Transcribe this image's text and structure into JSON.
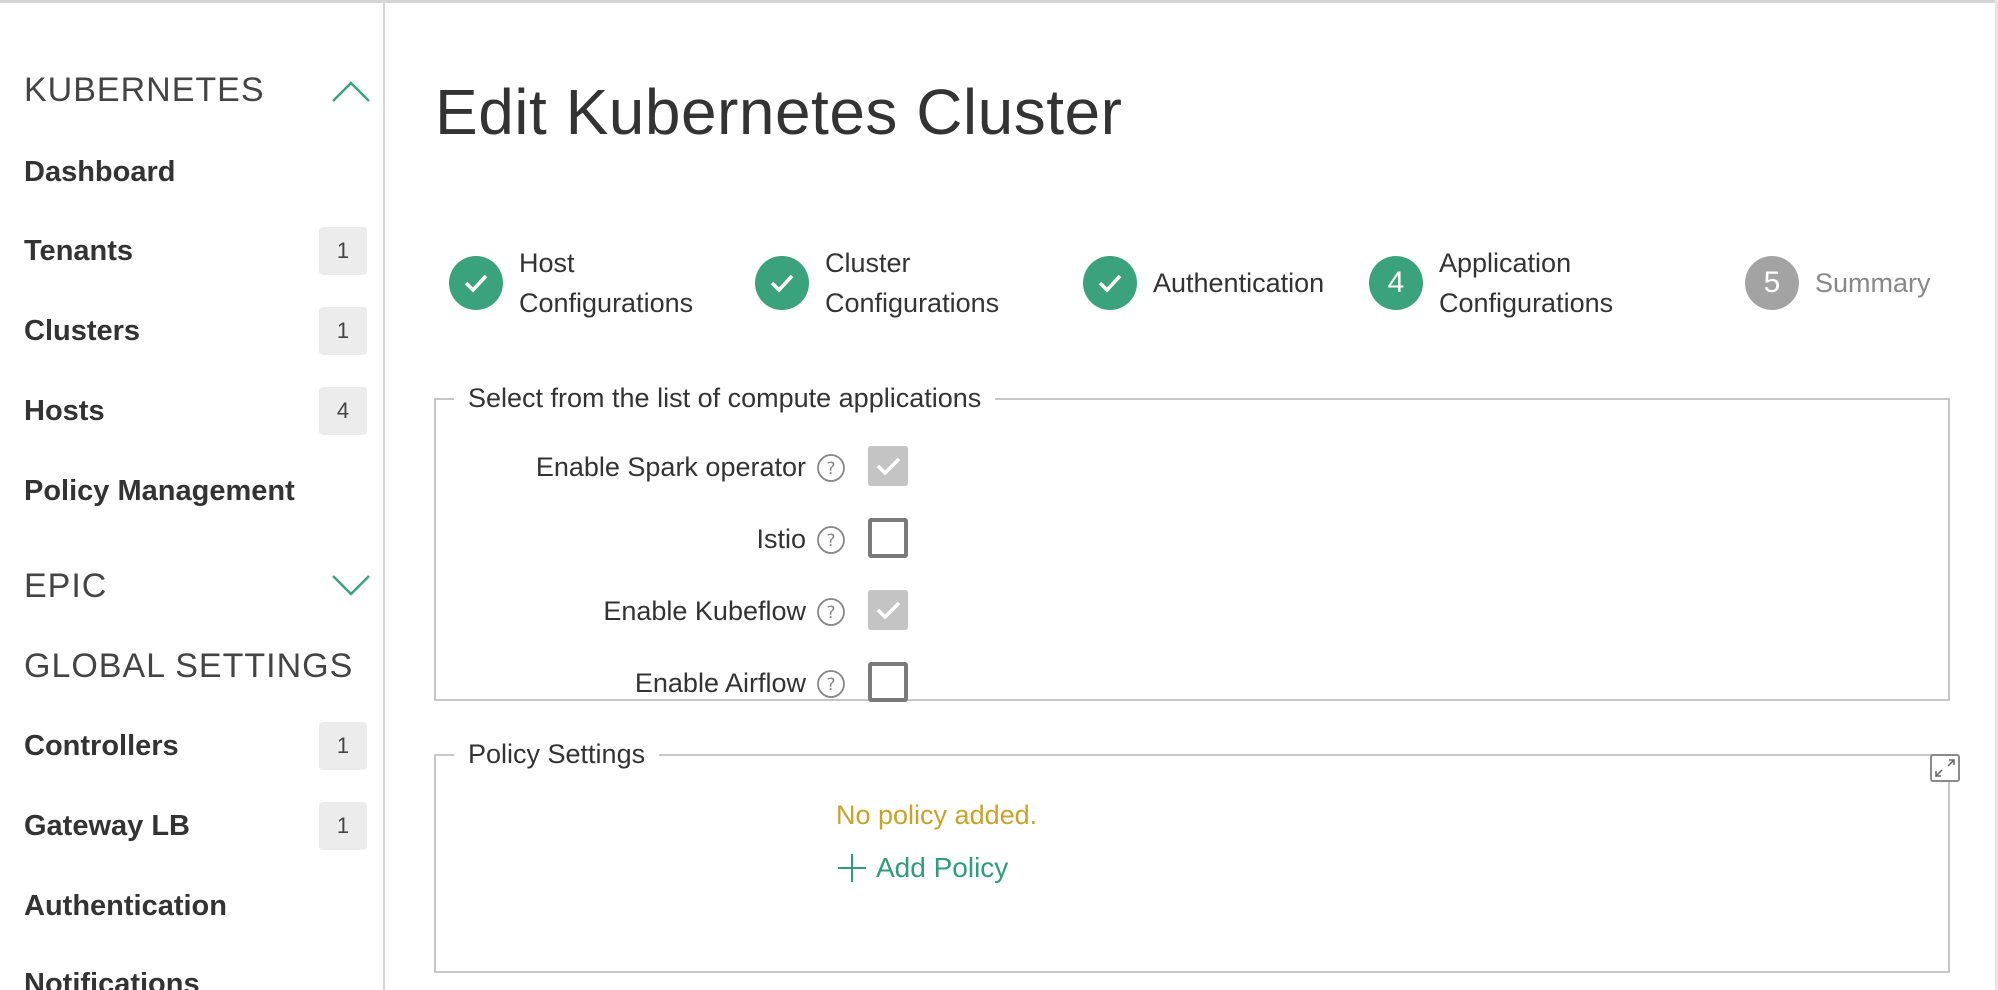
{
  "sidebar": {
    "kubernetes_heading": "KUBERNETES",
    "kubernetes_items": [
      {
        "label": "Dashboard",
        "badge": ""
      },
      {
        "label": "Tenants",
        "badge": "1"
      },
      {
        "label": "Clusters",
        "badge": "1"
      },
      {
        "label": "Hosts",
        "badge": "4"
      },
      {
        "label": "Policy Management",
        "badge": ""
      }
    ],
    "epic_heading": "EPIC",
    "global_heading": "GLOBAL SETTINGS",
    "global_items": [
      {
        "label": "Controllers",
        "badge": "1"
      },
      {
        "label": "Gateway LB",
        "badge": "1"
      },
      {
        "label": "Authentication",
        "badge": ""
      },
      {
        "label": "Notifications",
        "badge": ""
      }
    ]
  },
  "main": {
    "title": "Edit Kubernetes Cluster",
    "steps": [
      {
        "line1": "Host",
        "line2": "Configurations",
        "state": "complete",
        "number": ""
      },
      {
        "line1": "Cluster",
        "line2": "Configurations",
        "state": "complete",
        "number": ""
      },
      {
        "line1": "Authentication",
        "line2": "",
        "state": "complete",
        "number": ""
      },
      {
        "line1": "Application",
        "line2": "Configurations",
        "state": "current",
        "number": "4"
      },
      {
        "line1": "Summary",
        "line2": "",
        "state": "upcoming",
        "number": "5"
      }
    ],
    "apps_legend": "Select from the list of compute applications",
    "apps": [
      {
        "label": "Enable Spark operator",
        "checked": true
      },
      {
        "label": "Istio",
        "checked": false
      },
      {
        "label": "Enable Kubeflow",
        "checked": true
      },
      {
        "label": "Enable Airflow",
        "checked": false
      }
    ],
    "policy_legend": "Policy Settings",
    "no_policy_text": "No policy added.",
    "add_policy_label": "Add Policy"
  },
  "colors": {
    "accent": "#3ba27e",
    "upcoming": "#a3a3a3",
    "warning_text": "#c9a227",
    "checked_fill": "#c4c4c4"
  }
}
